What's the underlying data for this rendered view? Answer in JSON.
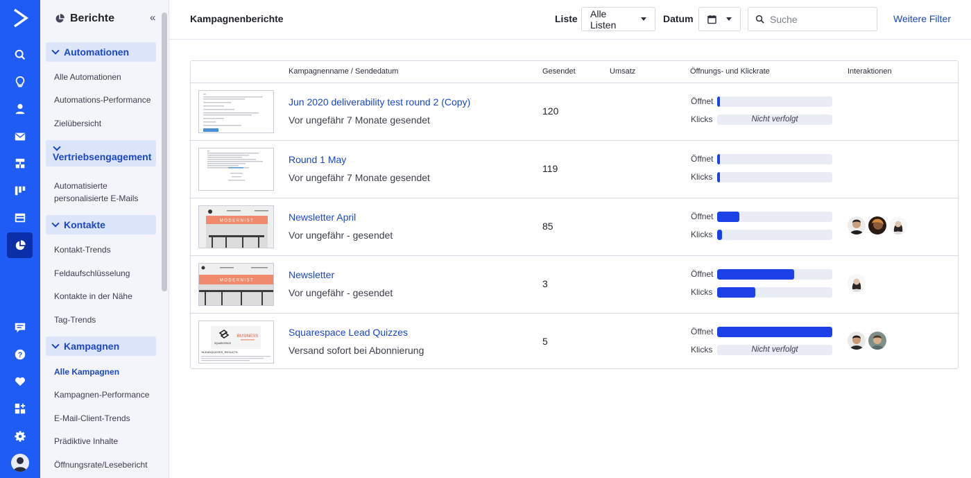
{
  "sidebar": {
    "title": "Berichte",
    "groups": [
      {
        "label": "Automationen",
        "items": [
          "Alle Automationen",
          "Automations-Performance",
          "Zielübersicht"
        ]
      },
      {
        "label": "Vertriebsengagement",
        "items": [
          "Automatisierte personalisierte E-Mails"
        ]
      },
      {
        "label": "Kontakte",
        "items": [
          "Kontakt-Trends",
          "Feldaufschlüsselung",
          "Kontakte in der Nähe",
          "Tag-Trends"
        ]
      },
      {
        "label": "Kampagnen",
        "items": [
          "Alle Kampagnen",
          "Kampagnen-Performance",
          "E-Mail-Client-Trends",
          "Prädiktive Inhalte",
          "Öffnungsrate/Lesebericht"
        ]
      }
    ],
    "active_item": "Alle Kampagnen"
  },
  "header": {
    "title": "Kampagnenberichte",
    "list_label": "Liste",
    "list_value": "Alle Listen",
    "date_label": "Datum",
    "search_placeholder": "Suche",
    "more_filters": "Weitere Filter"
  },
  "table": {
    "columns": [
      "Kampagnenname / Sendedatum",
      "Gesendet",
      "Umsatz",
      "Öffnungs- und Klickrate",
      "Interaktionen"
    ],
    "open_label": "Öffnet",
    "click_label": "Klicks",
    "not_tracked": "Nicht verfolgt",
    "rows": [
      {
        "name": "Jun 2020 deliverability test round 2 (Copy)",
        "sub": "Vor ungefähr 7 Monate gesendet",
        "sent": "120",
        "open_rate": 0.02,
        "click_rate": null,
        "avatars": 0
      },
      {
        "name": "Round 1 May",
        "sub": "Vor ungefähr 7 Monate gesendet",
        "sent": "119",
        "open_rate": 0.015,
        "click_rate": 0.015,
        "avatars": 0
      },
      {
        "name": "Newsletter April",
        "sub": "Vor ungefähr - gesendet",
        "sent": "85",
        "open_rate": 0.19,
        "click_rate": 0.04,
        "avatars": 3
      },
      {
        "name": "Newsletter",
        "sub": "Vor ungefähr - gesendet",
        "sent": "3",
        "open_rate": 0.67,
        "click_rate": 0.33,
        "avatars": 1
      },
      {
        "name": "Squarespace Lead Quizzes",
        "sub": "Versand sofort bei Abonnierung",
        "sent": "5",
        "open_rate": 1.0,
        "click_rate": null,
        "avatars": 2
      }
    ]
  },
  "thumbnails": {
    "modernist_text": "MODERNIST",
    "business_text": "BUSINESS",
    "squarespace_text": "SQUARESPACE",
    "quiz_text": "%LEADQUIZZES_RESULT%"
  },
  "colors": {
    "brand": "#1f5cf5",
    "bar": "#1c41e8",
    "link": "#1a47c9"
  },
  "icons": [
    "logo-icon",
    "search-icon",
    "lightbulb-icon",
    "contacts-icon",
    "mail-icon",
    "automation-icon",
    "deals-icon",
    "site-icon",
    "reports-icon",
    "conversations-icon",
    "help-icon",
    "heart-icon",
    "apps-icon",
    "settings-icon",
    "avatar"
  ]
}
